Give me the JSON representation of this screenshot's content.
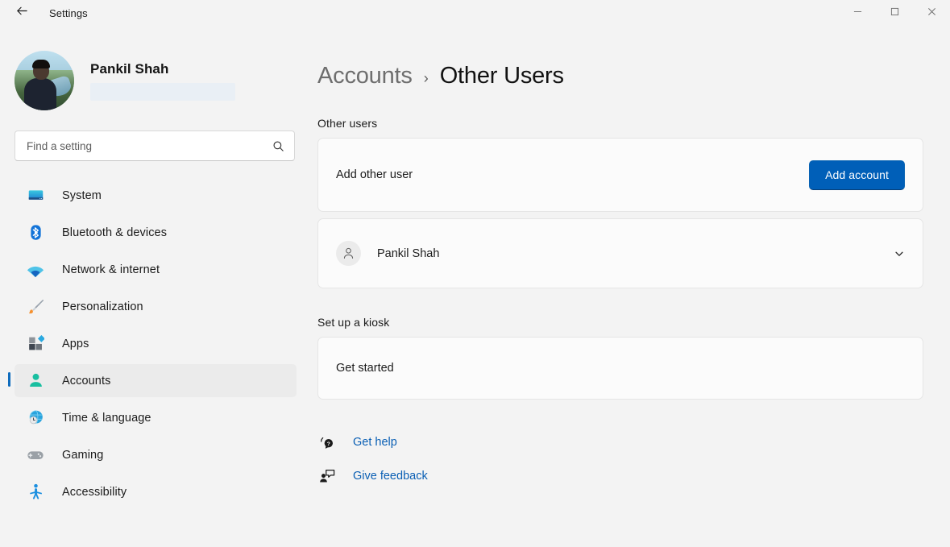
{
  "titlebar": {
    "back_label": "back-arrow",
    "app_title": "Settings",
    "minimize": "minimize",
    "maximize": "maximize",
    "close": "close"
  },
  "sidebar": {
    "profile": {
      "name": "Pankil Shah",
      "email_redacted": ""
    },
    "search": {
      "placeholder": "Find a setting",
      "value": "",
      "icon": "search-icon"
    },
    "items": [
      {
        "label": "System",
        "icon": "monitor-icon",
        "selected": false
      },
      {
        "label": "Bluetooth & devices",
        "icon": "bluetooth-icon",
        "selected": false
      },
      {
        "label": "Network & internet",
        "icon": "wifi-icon",
        "selected": false
      },
      {
        "label": "Personalization",
        "icon": "paintbrush-icon",
        "selected": false
      },
      {
        "label": "Apps",
        "icon": "apps-icon",
        "selected": false
      },
      {
        "label": "Accounts",
        "icon": "person-icon",
        "selected": true
      },
      {
        "label": "Time & language",
        "icon": "globe-clock-icon",
        "selected": false
      },
      {
        "label": "Gaming",
        "icon": "gamepad-icon",
        "selected": false
      },
      {
        "label": "Accessibility",
        "icon": "accessibility-icon",
        "selected": false
      }
    ]
  },
  "main": {
    "breadcrumb": {
      "parent": "Accounts",
      "separator": "›",
      "current": "Other Users"
    },
    "other_users": {
      "section_label": "Other users",
      "add_row_label": "Add other user",
      "add_button_label": "Add account",
      "user": {
        "name": "Pankil Shah",
        "avatar_icon": "person-avatar-icon",
        "expand_icon": "chevron-down-icon"
      }
    },
    "kiosk": {
      "section_label": "Set up a kiosk",
      "row_label": "Get started"
    },
    "links": [
      {
        "label": "Get help",
        "icon": "help-question-icon"
      },
      {
        "label": "Give feedback",
        "icon": "feedback-person-icon"
      }
    ]
  },
  "colors": {
    "accent": "#005fb8",
    "link": "#0a5fb4",
    "page_bg": "#f3f3f3",
    "card_bg": "#fbfbfb",
    "selected_bg": "#ebebeb",
    "selection_indicator": "#0f6cbd"
  }
}
